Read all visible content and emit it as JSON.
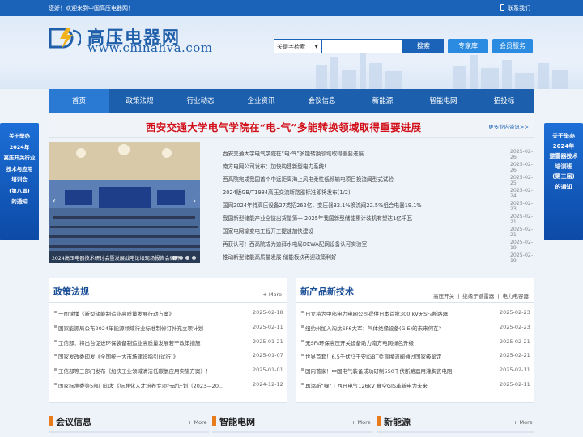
{
  "topbar": {
    "welcome": "您好！欢迎来到中国高压电器网！",
    "contact": "联系我们"
  },
  "header": {
    "logo_cn": "高压电器网",
    "logo_en": "www.chinahva.com",
    "search_select": "关键字检索",
    "search_placeholder": "",
    "search_button": "搜索",
    "expert_button": "专家库",
    "member_button": "会员服务"
  },
  "nav": [
    "首页",
    "政策法规",
    "行业动态",
    "企业资讯",
    "会议信息",
    "新能源",
    "智能电网",
    "招投标"
  ],
  "headline": {
    "title": "西安交通大学电气学院在“电-气”多能转换领域取得重要进展",
    "more": "更多业内资讯>>"
  },
  "side_left": [
    "关于举办",
    "2024年",
    "高压开关行业",
    "技术与应用",
    "培训会",
    "(第八届)",
    "的通知"
  ],
  "side_right": [
    "关于举办",
    "2024年",
    "避雷器技术",
    "培训班",
    "(第三届)",
    "的通知"
  ],
  "slider": {
    "caption": "2024高压电器技术研讨会暨发展战略论坛现场报告会召开"
  },
  "news": [
    {
      "title": "西安交通大学电气学院在“电-气”多能转换领域取得重要进展",
      "date": "2025-02-26"
    },
    {
      "title": "南方电网公司发布：加快构建新型电力系统!",
      "date": "2025-02-26"
    },
    {
      "title": "西高院完成我国首个中远距离海上风电柔性低频输电项目换流阀型式试验",
      "date": "2025-02-25"
    },
    {
      "title": "2024版GB/T1984高压交流断路器标准即将发布(1/2)",
      "date": "2025-02-24"
    },
    {
      "title": "国网2024年特高压设备27类招262亿，变压器32.1%换流阀22.5%组合电器19.1%",
      "date": "2025-02-23"
    },
    {
      "title": "我国新型储能产业全链出货量第一 2025年我国新型储能累计装机有望达1亿千瓦",
      "date": "2025-02-21"
    },
    {
      "title": "国家电网输变电工程开工提速加快建设",
      "date": "2025-02-21"
    },
    {
      "title": "再获认可！西高院成为迪拜水电局DEWA配网设备认可实验室",
      "date": "2025-02-19"
    },
    {
      "title": "推动新型储能高质量发展 储能板块再迎政策利好",
      "date": "2025-02-19"
    }
  ],
  "policy_box": {
    "title": "政策法规",
    "more": "+ More",
    "items": [
      {
        "title": "一图读懂《新型储能制造业高质量发展行动方案》",
        "date": "2025-02-18"
      },
      {
        "title": "国家能源局公布2024年能源领域行业标准制修订补充立项计划",
        "date": "2025-02-11"
      },
      {
        "title": "工信部：将出台促进环保装备制造业高质量发展若干政策措施",
        "date": "2025-01-21"
      },
      {
        "title": "国家发改委印发《全国统一大市场建设指引(试行)》",
        "date": "2025-01-07"
      },
      {
        "title": "工信部等三部门发布《加快工业领域清洁低碳氢应用实施方案》！",
        "date": "2025-01-01"
      },
      {
        "title": "国家标准委等5部门印发《标准化人才培养专项行动计划（2023—20...",
        "date": "2024-12-12"
      }
    ]
  },
  "product_box": {
    "title": "新产品新技术",
    "tabs": [
      "高压开关",
      "绝缘子避雷器",
      "电力电容器"
    ],
    "items": [
      {
        "title": "日立将为中部电力电网公司提供日本首批300 kV无SF₆断路器",
        "date": "2025-02-23"
      },
      {
        "title": "纽约州加入淘汰SF6大军：气体绝缘设备(GIE)的未来何在?",
        "date": "2025-02-23"
      },
      {
        "title": "无SF₆环保高压开关设备助力南方电网绿色升级",
        "date": "2025-02-21"
      },
      {
        "title": "世界首套！6.5千伏/3千安IGBT柔直换流阀通过国家级鉴定",
        "date": "2025-02-21"
      },
      {
        "title": "国内首家！中国电气装备成功研制550千伏断路器用灌胸瓷电阻",
        "date": "2025-02-11"
      },
      {
        "title": "再添新“绿”｜西开电气126kV 真空GIS革新电力未来",
        "date": "2025-02-11"
      }
    ]
  },
  "bottom_sections": [
    {
      "title": "会议信息",
      "more": "+ More"
    },
    {
      "title": "智能电网",
      "more": "+ More"
    },
    {
      "title": "新能源",
      "more": "+ More"
    }
  ],
  "colors": {
    "brand_blue": "#1a63b8",
    "nav_blue": "#1c5fad",
    "headline_red": "#d2101a",
    "accent_orange": "#e87b1a"
  }
}
